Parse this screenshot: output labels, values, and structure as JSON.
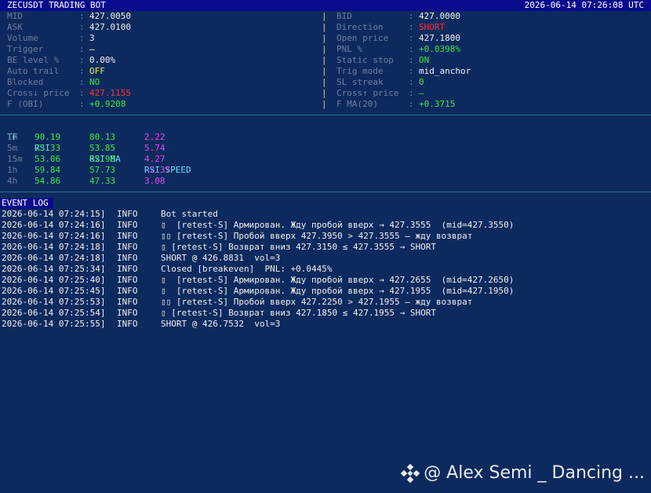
{
  "titlebar": {
    "title": "ZECUSDT TRADING BOT",
    "clock": "2026-06-14 07:26:08 UTC"
  },
  "colon": ":",
  "divider": "|",
  "stats": {
    "left": [
      {
        "label": "MID",
        "value": "427.0050",
        "color": "#f0f0f0"
      },
      {
        "label": "ASK",
        "value": "427.0100",
        "color": "#f0f0f0"
      },
      {
        "label": "Volume",
        "value": "3",
        "color": "#f0f0f0"
      },
      {
        "label": "Trigger",
        "value": "—",
        "color": "#f0f0f0"
      },
      {
        "label": "BE level %",
        "value": "0.00%",
        "color": "#f0f0f0"
      },
      {
        "label": "Auto trail",
        "value": "OFF",
        "color": "#f2f23c"
      },
      {
        "label": "Blocked",
        "value": "NO",
        "color": "#3ee83e"
      },
      {
        "label": "Cross↓ price",
        "value": "427.1155",
        "color": "#ff3333"
      },
      {
        "label": "F (OBI)",
        "value": "+0.9208",
        "color": "#3ee83e"
      }
    ],
    "right": [
      {
        "label": "BID",
        "value": "427.0000",
        "color": "#f0f0f0"
      },
      {
        "label": "Direction",
        "value": "SHORT",
        "color": "#ff3333"
      },
      {
        "label": "Open price",
        "value": "427.1800",
        "color": "#f0f0f0"
      },
      {
        "label": "PNL %",
        "value": "+0.0398%",
        "color": "#3ee83e"
      },
      {
        "label": "Static stop",
        "value": "ON",
        "color": "#3ee83e"
      },
      {
        "label": "Trig mode",
        "value": "mid_anchor",
        "color": "#f0f0f0"
      },
      {
        "label": "SL streak",
        "value": "0",
        "color": "#3ee83e"
      },
      {
        "label": "Cross↑ price",
        "value": "—",
        "color": "#3ee83e"
      },
      {
        "label": "F MA(20)",
        "value": "+0.3715",
        "color": "#3ee83e"
      }
    ]
  },
  "rsi_table": {
    "headers": [
      "TF",
      "RSI",
      "RSI MA",
      "RSI SPEED"
    ],
    "rows": [
      {
        "tf": "1m",
        "rsi": "90.19",
        "ma": "80.13",
        "speed": "2.22"
      },
      {
        "tf": "5m",
        "rsi": "73.33",
        "ma": "53.85",
        "speed": "5.74"
      },
      {
        "tf": "15m",
        "rsi": "53.06",
        "ma": "52.98",
        "speed": "4.27"
      },
      {
        "tf": "1h",
        "rsi": "59.84",
        "ma": "57.73",
        "speed": "-2.37"
      },
      {
        "tf": "4h",
        "rsi": "54.86",
        "ma": "47.33",
        "speed": "3.08"
      }
    ]
  },
  "event_log": {
    "title": "EVENT LOG",
    "lines": [
      {
        "ts": "2026-06-14 07:24:15]",
        "level": "INFO",
        "msg": "Bot started"
      },
      {
        "ts": "2026-06-14 07:24:16]",
        "level": "INFO",
        "msg": "▯  [retest-S] Армирован. Жду пробой вверх → 427.3555  (mid=427.3550)"
      },
      {
        "ts": "2026-06-14 07:24:16]",
        "level": "INFO",
        "msg": "▯▯ [retest-S] Пробой вверх 427.3950 > 427.3555 — жду возврат"
      },
      {
        "ts": "2026-06-14 07:24:18]",
        "level": "INFO",
        "msg": "▯ [retest-S] Возврат вниз 427.3150 ≤ 427.3555 → SHORT"
      },
      {
        "ts": "2026-06-14 07:24:18]",
        "level": "INFO",
        "msg": "SHORT @ 426.8831  vol=3"
      },
      {
        "ts": "2026-06-14 07:25:34]",
        "level": "INFO",
        "msg": "Closed [breakeven]  PNL: +0.0445%"
      },
      {
        "ts": "2026-06-14 07:25:40]",
        "level": "INFO",
        "msg": "▯  [retest-S] Армирован. Жду пробой вверх → 427.2655  (mid=427.2650)"
      },
      {
        "ts": "2026-06-14 07:25:45]",
        "level": "INFO",
        "msg": "▯  [retest-S] Армирован. Жду пробой вверх → 427.1955  (mid=427.1950)"
      },
      {
        "ts": "2026-06-14 07:25:53]",
        "level": "INFO",
        "msg": "▯▯ [retest-S] Пробой вверх 427.2250 > 427.1955 — жду возврат"
      },
      {
        "ts": "2026-06-14 07:25:54]",
        "level": "INFO",
        "msg": "▯ [retest-S] Возврат вниз 427.1850 ≤ 427.1955 → SHORT"
      },
      {
        "ts": "2026-06-14 07:25:55]",
        "level": "INFO",
        "msg": "SHORT @ 426.7532  vol=3"
      }
    ]
  },
  "watermark": {
    "text": "@ Alex Semi _ Dancing ...",
    "icon": "diamond-logo-icon"
  }
}
